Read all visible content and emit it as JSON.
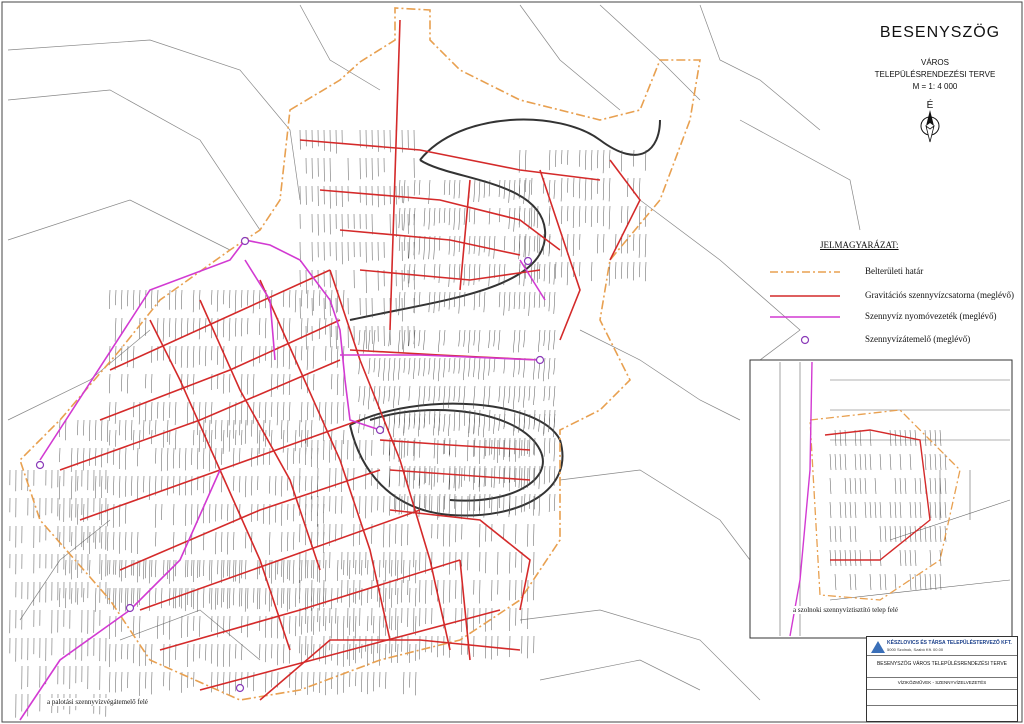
{
  "map": {
    "title": "BESENYSZÖG",
    "subtitle1": "VÁROS",
    "subtitle2": "TELEPÜLÉSRENDEZÉSI TERVE",
    "scale": "M = 1: 4 000",
    "north_label": "É",
    "notes": {
      "bottom_left": "a palotási szennyvízvégátemelő felé",
      "inset": "a szolnoki szennyvíztisztító telep felé"
    }
  },
  "legend": {
    "title": "JELMAGYARÁZAT:",
    "items": [
      {
        "label": "Belterületi határ",
        "color": "#e8a050"
      },
      {
        "label": "Gravitációs szennyvízcsatorna (meglévő)",
        "color": "#d42a2a"
      },
      {
        "label": "Szennyvíz nyomóvezeték (meglévő)",
        "color": "#d23ad2"
      },
      {
        "label": "Szennyvízátemelő (meglévő)",
        "color": "#8a3ab8"
      }
    ]
  },
  "title_block": {
    "company": "KÉSZLOVICS ÉS TÁRSA TELEPÜLÉSTERVEZŐ KFT.",
    "address": "5000 Szolnok, Szabó Kft. 00.00",
    "project": "BESENYSZÖG VÁROS TELEPÜLÉSRENDEZÉSI TERVE",
    "sheet": "VÍZIKÖZMŰVEK - SZENNYVÍZELVEZETÉS"
  },
  "colors": {
    "boundary": "#e8a050",
    "gravity_sewer": "#d42a2a",
    "pressure_main": "#d23ad2",
    "parcels": "#555555"
  }
}
